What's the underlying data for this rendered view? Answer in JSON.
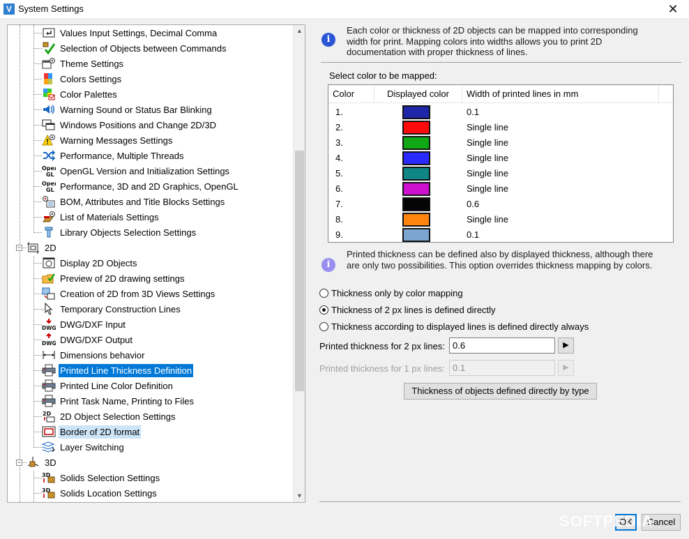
{
  "window": {
    "icon": "V",
    "title": "System Settings",
    "close_glyph": "✕"
  },
  "tree": {
    "items": [
      {
        "label": "Values Input Settings, Decimal Comma",
        "icon": "input-icon",
        "level": 2
      },
      {
        "label": "Selection of Objects between Commands",
        "icon": "selection-check-icon",
        "level": 2
      },
      {
        "label": "Theme Settings",
        "icon": "theme-settings-icon",
        "level": 2
      },
      {
        "label": "Colors Settings",
        "icon": "colors-icon",
        "level": 2
      },
      {
        "label": "Color Palettes",
        "icon": "color-palettes-icon",
        "level": 2
      },
      {
        "label": "Warning Sound or Status Bar Blinking",
        "icon": "speaker-icon",
        "level": 2
      },
      {
        "label": "Windows Positions and Change 2D/3D",
        "icon": "windows-icon",
        "level": 2
      },
      {
        "label": "Warning Messages Settings",
        "icon": "warning-icon",
        "level": 2
      },
      {
        "label": "Performance, Multiple Threads",
        "icon": "shuffle-icon",
        "level": 2
      },
      {
        "label": "OpenGL Version and Initialization Settings",
        "icon": "opengl-icon",
        "level": 2
      },
      {
        "label": "Performance, 3D and 2D Graphics, OpenGL",
        "icon": "opengl-icon",
        "level": 2
      },
      {
        "label": "BOM, Attributes and Title Blocks Settings",
        "icon": "bom-icon",
        "level": 2
      },
      {
        "label": "List of Materials Settings",
        "icon": "materials-icon",
        "level": 2
      },
      {
        "label": "Library Objects Selection Settings",
        "icon": "library-icon",
        "level": 2
      },
      {
        "label": "2D",
        "icon": "2d-group-icon",
        "level": 1,
        "expander": "−"
      },
      {
        "label": "Display 2D Objects",
        "icon": "display-2d-icon",
        "level": 2
      },
      {
        "label": "Preview of 2D drawing settings",
        "icon": "folder-check-icon",
        "level": 2
      },
      {
        "label": "Creation of 2D from 3D Views Settings",
        "icon": "views-icon",
        "level": 2
      },
      {
        "label": "Temporary Construction Lines",
        "icon": "cursor-icon",
        "level": 2
      },
      {
        "label": "DWG/DXF Input",
        "icon": "dwg-input-icon",
        "level": 2
      },
      {
        "label": "DWG/DXF Output",
        "icon": "dwg-output-icon",
        "level": 2
      },
      {
        "label": "Dimensions behavior",
        "icon": "dimension-icon",
        "level": 2
      },
      {
        "label": "Printed Line Thickness Definition",
        "icon": "printer-icon",
        "level": 2,
        "state": "selected"
      },
      {
        "label": "Printed Line Color Definition",
        "icon": "printer-icon",
        "level": 2
      },
      {
        "label": "Print Task Name, Printing to Files",
        "icon": "printer-icon",
        "level": 2
      },
      {
        "label": "2D Object Selection Settings",
        "icon": "2d-selection-icon",
        "level": 2
      },
      {
        "label": "Border of 2D format",
        "icon": "border-icon",
        "level": 2,
        "state": "hilite"
      },
      {
        "label": "Layer Switching",
        "icon": "layers-icon",
        "level": 2
      },
      {
        "label": "3D",
        "icon": "3d-group-icon",
        "level": 1,
        "expander": "−"
      },
      {
        "label": "Solids Selection Settings",
        "icon": "3d-solid-icon",
        "level": 2
      },
      {
        "label": "Solids Location Settings",
        "icon": "3d-solid-icon",
        "level": 2
      }
    ]
  },
  "info1": {
    "text": "Each color or thickness of 2D objects can be mapped into corresponding width for print. Mapping colors into widths allows you to print 2D documentation with proper thickness of lines."
  },
  "mapping": {
    "label": "Select color to be mapped:",
    "columns": [
      "Color",
      "Displayed color",
      "Width of printed lines in mm"
    ],
    "rows": [
      {
        "num": "1.",
        "color": "#1f27a8",
        "width": "0.1"
      },
      {
        "num": "2.",
        "color": "#ff0a0a",
        "width": "Single line"
      },
      {
        "num": "3.",
        "color": "#10a814",
        "width": "Single line"
      },
      {
        "num": "4.",
        "color": "#2a2aff",
        "width": "Single line"
      },
      {
        "num": "5.",
        "color": "#0f8585",
        "width": "Single line"
      },
      {
        "num": "6.",
        "color": "#d010d0",
        "width": "Single line"
      },
      {
        "num": "7.",
        "color": "#050505",
        "width": "0.6"
      },
      {
        "num": "8.",
        "color": "#ff8410",
        "width": "Single line"
      },
      {
        "num": "9.",
        "color": "#7ba6d2",
        "width": "0.1"
      }
    ]
  },
  "info2": {
    "text": "Printed thickness can be defined also by displayed thickness, although there are only two possibilities. This option overrides thickness mapping by colors."
  },
  "options": [
    {
      "label": "Thickness only by color mapping",
      "checked": false
    },
    {
      "label": "Thickness of 2 px lines is defined directly",
      "checked": true
    },
    {
      "label": "Thickness according to displayed lines is defined directly always",
      "checked": false
    }
  ],
  "fields": {
    "px2_label": "Printed thickness for 2 px lines:",
    "px2_value": "0.6",
    "px1_label": "Printed thickness for 1 px lines:",
    "px1_value": "0.1",
    "spin_glyph": "▶"
  },
  "buttons": {
    "by_type": "Thickness of objects defined directly by type",
    "ok": "OK",
    "cancel": "Cancel"
  },
  "watermark": "SOFTPEDIA"
}
